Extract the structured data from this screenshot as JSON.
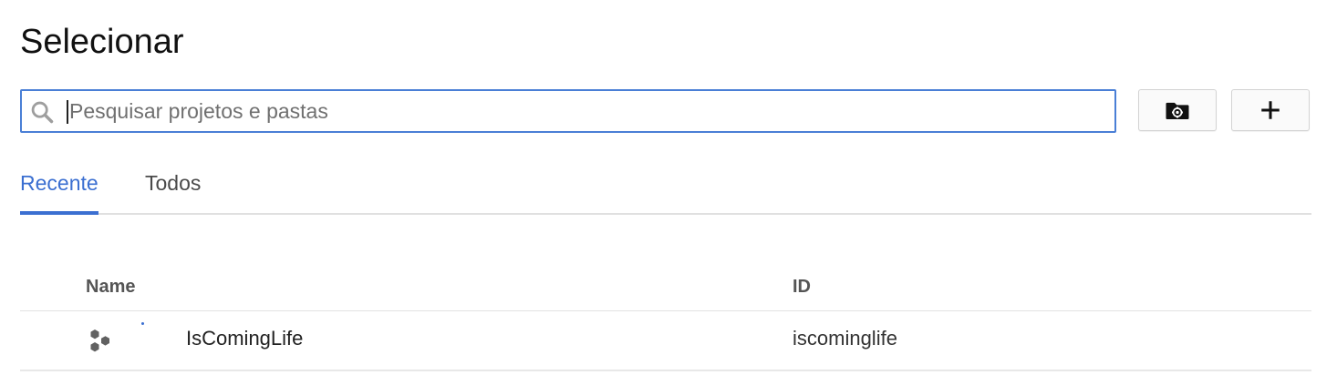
{
  "dialog": {
    "title": "Selecionar"
  },
  "search": {
    "placeholder": "Pesquisar projetos e pastas",
    "value": ""
  },
  "toolbar": {
    "new_folder_icon": "folder-settings-icon",
    "add_icon": "plus-icon"
  },
  "tabs": [
    {
      "label": "Recente",
      "active": true
    },
    {
      "label": "Todos",
      "active": false
    }
  ],
  "table": {
    "columns": [
      "Name",
      "ID"
    ],
    "rows": [
      {
        "icon": "project-hexagons-icon",
        "name": "IsComingLife",
        "id": "iscominglife"
      }
    ]
  },
  "colors": {
    "accent": "#3b6fd1",
    "search_border": "#4a7fd6",
    "divider": "#e0e0e0"
  }
}
